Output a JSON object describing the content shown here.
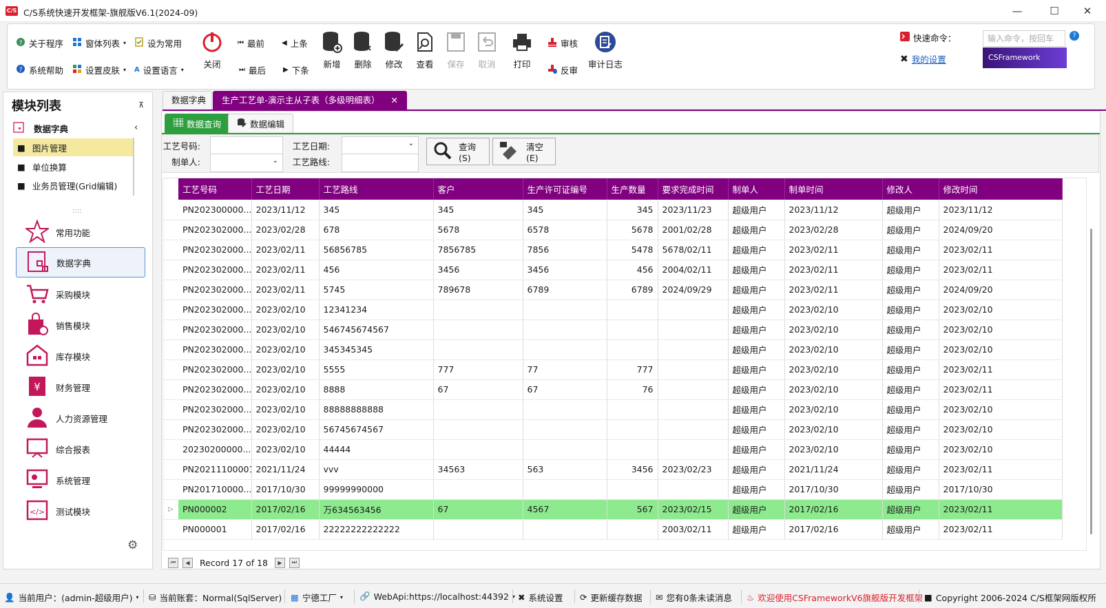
{
  "window": {
    "logo": "C/S",
    "title": "C/S系统快速开发框架-旗舰版V6.1(2024-09)",
    "minimize": "—",
    "maximize": "☐",
    "close": "✕"
  },
  "ribbon": {
    "small": [
      {
        "label": "关于程序",
        "icon": "info-icon"
      },
      {
        "label": "窗体列表",
        "icon": "windows-icon"
      },
      {
        "label": "设为常用",
        "icon": "bookmark-icon"
      },
      {
        "label": "系统帮助",
        "icon": "help-icon"
      },
      {
        "label": "设置皮肤",
        "icon": "skin-icon"
      },
      {
        "label": "设置语言",
        "icon": "language-icon"
      }
    ],
    "close": "关闭",
    "nav": {
      "first": "最前",
      "prev": "上条",
      "last": "最后",
      "next": "下条"
    },
    "actions": {
      "add": "新增",
      "delete": "删除",
      "edit": "修改",
      "view": "查看",
      "save": "保存",
      "cancel": "取消",
      "print": "打印",
      "audit": "审核",
      "unaudit": "反审",
      "log": "审计日志"
    },
    "quick_label": "快速命令：",
    "cmd_placeholder": "输入命令，按回车",
    "my_settings": "我的设置",
    "brand": "CSFramework"
  },
  "sidebar": {
    "title": "模块列表",
    "group": "数据字典",
    "tree": [
      "图片管理",
      "单位换算",
      "业务员管理(Grid编辑)"
    ],
    "handle": "::::",
    "modules": [
      "常用功能",
      "数据字典",
      "采购模块",
      "销售模块",
      "库存模块",
      "财务管理",
      "人力资源管理",
      "综合报表",
      "系统管理",
      "测试模块"
    ]
  },
  "tabs": [
    "数据字典",
    "生产工艺单-演示主从子表（多级明细表）"
  ],
  "subtabs": [
    "数据查询",
    "数据编辑"
  ],
  "query": {
    "l1": "工艺号码:",
    "l2": "制单人:",
    "l3": "工艺日期:",
    "l4": "工艺路线:",
    "search": "查询(S)",
    "clear": "清空(E)"
  },
  "grid": {
    "columns": [
      "工艺号码",
      "工艺日期",
      "工艺路线",
      "客户",
      "生产许可证编号",
      "生产数量",
      "要求完成时间",
      "制单人",
      "制单时间",
      "修改人",
      "修改时间"
    ],
    "rows": [
      [
        "PN202300000...",
        "2023/11/12",
        "345",
        "345",
        "345",
        "345",
        "2023/11/23",
        "超级用户",
        "2023/11/12",
        "超级用户",
        "2023/11/12"
      ],
      [
        "PN202302000...",
        "2023/02/28",
        "678",
        "5678",
        "6578",
        "5678",
        "2001/02/28",
        "超级用户",
        "2023/02/28",
        "超级用户",
        "2024/09/20"
      ],
      [
        "PN202302000...",
        "2023/02/11",
        "56856785",
        "7856785",
        "7856",
        "5478",
        "5678/02/11",
        "超级用户",
        "2023/02/11",
        "超级用户",
        "2023/02/11"
      ],
      [
        "PN202302000...",
        "2023/02/11",
        "456",
        "3456",
        "3456",
        "456",
        "2004/02/11",
        "超级用户",
        "2023/02/11",
        "超级用户",
        "2023/02/11"
      ],
      [
        "PN202302000...",
        "2023/02/11",
        "5745",
        "789678",
        "6789",
        "6789",
        "2024/09/29",
        "超级用户",
        "2023/02/11",
        "超级用户",
        "2024/09/20"
      ],
      [
        "PN202302000...",
        "2023/02/10",
        "12341234",
        "",
        "",
        "",
        "",
        "超级用户",
        "2023/02/10",
        "超级用户",
        "2023/02/10"
      ],
      [
        "PN202302000...",
        "2023/02/10",
        "546745674567",
        "",
        "",
        "",
        "",
        "超级用户",
        "2023/02/10",
        "超级用户",
        "2023/02/10"
      ],
      [
        "PN202302000...",
        "2023/02/10",
        "345345345",
        "",
        "",
        "",
        "",
        "超级用户",
        "2023/02/10",
        "超级用户",
        "2023/02/10"
      ],
      [
        "PN202302000...",
        "2023/02/10",
        "5555",
        "777",
        "77",
        "777",
        "",
        "超级用户",
        "2023/02/10",
        "超级用户",
        "2023/02/11"
      ],
      [
        "PN202302000...",
        "2023/02/10",
        "8888",
        "67",
        "67",
        "76",
        "",
        "超级用户",
        "2023/02/10",
        "超级用户",
        "2023/02/11"
      ],
      [
        "PN202302000...",
        "2023/02/10",
        "88888888888",
        "",
        "",
        "",
        "",
        "超级用户",
        "2023/02/10",
        "超级用户",
        "2023/02/10"
      ],
      [
        "PN202302000...",
        "2023/02/10",
        "56745674567",
        "",
        "",
        "",
        "",
        "超级用户",
        "2023/02/10",
        "超级用户",
        "2023/02/10"
      ],
      [
        "20230200000...",
        "2023/02/10",
        "44444",
        "",
        "",
        "",
        "",
        "超级用户",
        "2023/02/10",
        "超级用户",
        "2023/02/10"
      ],
      [
        "PN20211100001",
        "2021/11/24",
        "vvv",
        "34563",
        "563",
        "3456",
        "2023/02/23",
        "超级用户",
        "2021/11/24",
        "超级用户",
        "2023/02/11"
      ],
      [
        "PN201710000...",
        "2017/10/30",
        "99999990000",
        "",
        "",
        "",
        "",
        "超级用户",
        "2017/10/30",
        "超级用户",
        "2017/10/30"
      ],
      [
        "PN000002",
        "2017/02/16",
        "万634563456",
        "67",
        "4567",
        "567",
        "2023/02/15",
        "超级用户",
        "2017/02/16",
        "超级用户",
        "2023/02/11"
      ],
      [
        "PN000001",
        "2017/02/16",
        "22222222222222",
        "",
        "",
        "",
        "2003/02/11",
        "超级用户",
        "2017/02/16",
        "超级用户",
        "2023/02/11"
      ]
    ],
    "selected_row": 15,
    "record": "Record 17 of 18"
  },
  "status": [
    "当前用户：(admin-超级用户)",
    "当前账套：Normal(SqlServer)",
    "宁德工厂",
    "WebApi:https://localhost:44392",
    "系统设置",
    "更新缓存数据",
    "您有0条未读消息",
    "欢迎使用CSFrameworkV6旗舰版开发框架",
    "Copyright 2006-2024 C/S框架网版权所"
  ],
  "colors": {
    "accent": "#800080",
    "selected": "#8eea8e",
    "welcome": "#d9202f"
  }
}
